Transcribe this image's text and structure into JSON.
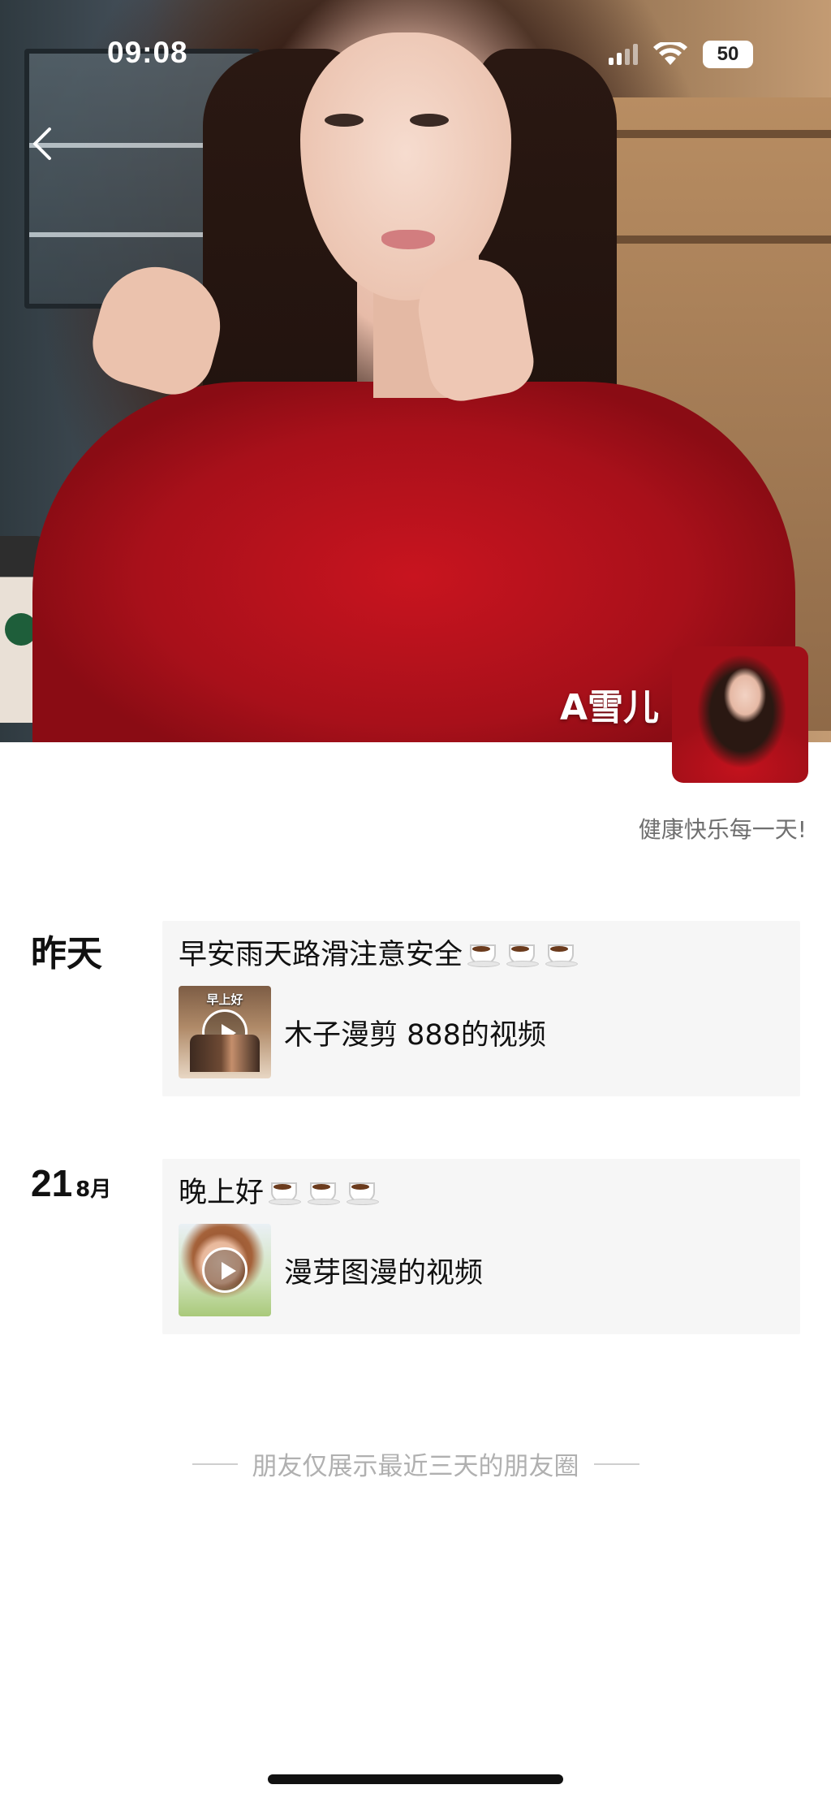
{
  "status_bar": {
    "time": "09:08",
    "battery": "50",
    "icons": [
      "signal-icon",
      "wifi-icon",
      "battery-icon"
    ]
  },
  "header": {
    "back_icon": "chevron-left-icon",
    "nickname": "A雪儿",
    "signature": "健康快乐每一天!"
  },
  "posts": [
    {
      "date_label": "昨天",
      "text": "早安雨天路滑注意安全",
      "emoji_count": 3,
      "video": {
        "title": "木子漫剪 888的视频",
        "thumb_caption": "早上好"
      }
    },
    {
      "date_day": "21",
      "date_month": "8月",
      "text": "晚上好",
      "emoji_count": 3,
      "video": {
        "title": "漫芽图漫的视频"
      }
    }
  ],
  "footer": {
    "note": "朋友仅展示最近三天的朋友圈"
  },
  "colors": {
    "post_bg": "#f6f6f6",
    "muted_text": "#b0b0b0",
    "signature_text": "#6f6f6f"
  }
}
